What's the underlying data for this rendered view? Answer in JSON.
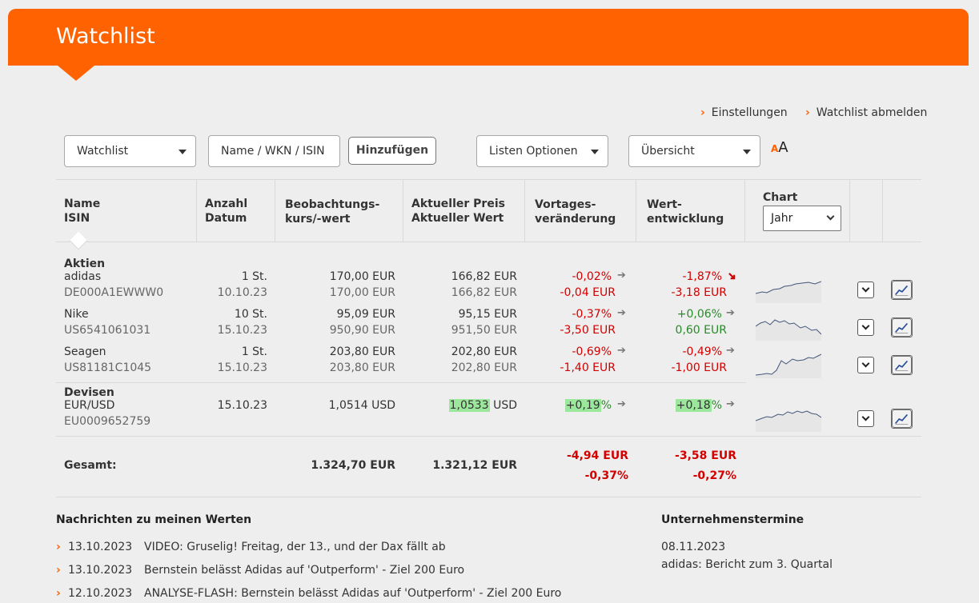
{
  "header": {
    "title": "Watchlist"
  },
  "links": {
    "settings": "Einstellungen",
    "unsubscribe": "Watchlist abmelden"
  },
  "controls": {
    "watchlist_select": "Watchlist",
    "search_placeholder": "Name / WKN / ISIN",
    "add_button": "Hinzufügen",
    "list_options": "Listen Optionen",
    "view_select": "Übersicht",
    "font_small": "A",
    "font_big": "A"
  },
  "table": {
    "headers": {
      "name": [
        "Name",
        "ISIN"
      ],
      "qty": [
        "Anzahl",
        "Datum"
      ],
      "obs": [
        "Beobachtungs-",
        "kurs/-wert"
      ],
      "price": [
        "Aktueller Preis",
        "Aktueller Wert"
      ],
      "daychange": [
        "Vortages-",
        "veränderung"
      ],
      "perf": [
        "Wert-",
        "entwicklung"
      ],
      "chart": "Chart",
      "chart_period": "Jahr"
    },
    "groups": {
      "stocks": "Aktien",
      "fx": "Devisen"
    },
    "rows": [
      {
        "name": "adidas",
        "isin": "DE000A1EWWW0",
        "qty": "1 St.",
        "date": "10.10.23",
        "obs1": "170,00 EUR",
        "obs2": "170,00 EUR",
        "price1": "166,82 EUR",
        "price2": "166,82 EUR",
        "day1": "-0,02%",
        "day2": "-0,04 EUR",
        "perf1": "-1,87%",
        "perf2": "-3,18 EUR"
      },
      {
        "name": "Nike",
        "isin": "US6541061031",
        "qty": "10 St.",
        "date": "15.10.23",
        "obs1": "95,09 EUR",
        "obs2": "950,90 EUR",
        "price1": "95,15 EUR",
        "price2": "951,50 EUR",
        "day1": "-0,37%",
        "day2": "-3,50 EUR",
        "perf1": "+0,06%",
        "perf2": "0,60 EUR"
      },
      {
        "name": "Seagen",
        "isin": "US81181C1045",
        "qty": "1 St.",
        "date": "15.10.23",
        "obs1": "203,80 EUR",
        "obs2": "203,80 EUR",
        "price1": "202,80 EUR",
        "price2": "202,80 EUR",
        "day1": "-0,69%",
        "day2": "-1,40 EUR",
        "perf1": "-0,49%",
        "perf2": "-1,00 EUR"
      },
      {
        "name": "EUR/USD",
        "isin": "EU0009652759",
        "date": "15.10.23",
        "obs1": "1,0514 USD",
        "price_val": "1,0533",
        "price_unit": " USD",
        "day1": "+0,19",
        "day1_suffix": "%",
        "perf1": "+0,18",
        "perf1_suffix": "%"
      }
    ],
    "total": {
      "label": "Gesamt:",
      "obs": "1.324,70 EUR",
      "price": "1.321,12 EUR",
      "day1": "-4,94 EUR",
      "day2": "-0,37%",
      "perf1": "-3,58 EUR",
      "perf2": "-0,27%"
    }
  },
  "news": {
    "title": "Nachrichten zu meinen Werten",
    "items": [
      {
        "date": "13.10.2023",
        "text": "VIDEO: Gruselig! Freitag, der 13., und der Dax fällt ab"
      },
      {
        "date": "13.10.2023",
        "text": "Bernstein belässt Adidas auf 'Outperform' - Ziel 200 Euro"
      },
      {
        "date": "12.10.2023",
        "text": "ANALYSE-FLASH: Bernstein belässt Adidas auf 'Outperform' - Ziel 200 Euro"
      }
    ]
  },
  "events": {
    "title": "Unternehmenstermine",
    "date": "08.11.2023",
    "text": "adidas: Bericht zum 3. Quartal"
  },
  "colors": {
    "brand": "#ff6200",
    "negative": "#d40000",
    "positive": "#2a8a2a",
    "highlight": "#9be79b"
  }
}
